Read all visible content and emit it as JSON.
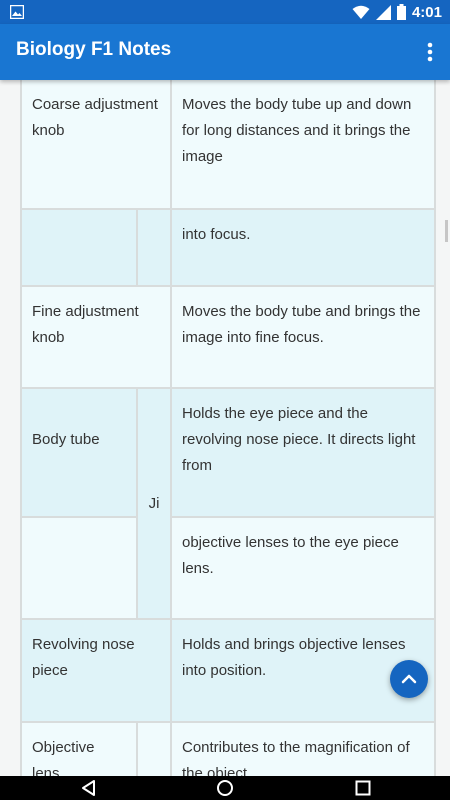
{
  "status_bar": {
    "time": "4:01",
    "icons": [
      "image-icon",
      "wifi-icon",
      "signal-icon",
      "battery-icon"
    ]
  },
  "app_bar": {
    "title": "Biology F1 Notes",
    "overflow_icon": "more-vert-icon"
  },
  "table": {
    "rows": [
      {
        "part": "Coarse adjustment knob",
        "function": "Moves the body tube up and down for long distances and it brings the image"
      },
      {
        "part": "",
        "function": "into focus."
      },
      {
        "part": "Fine adjustment knob",
        "function": "Moves the body tube and brings the image into fine focus."
      },
      {
        "part": "Body tube",
        "middle": "Ji",
        "function": "Holds the eye piece and the revolving nose piece. It directs light from"
      },
      {
        "part": "",
        "function": "objective lenses to the eye piece lens."
      },
      {
        "part": "Revolving nose piece",
        "function": "Holds and brings objective lenses into position."
      },
      {
        "part": "Objective lens",
        "function": "Contributes to the magnification of the object"
      }
    ]
  },
  "fab": {
    "icon": "chevron-up-icon"
  },
  "nav_bar": {
    "icons": [
      "back-icon",
      "home-icon",
      "recents-icon"
    ]
  },
  "colors": {
    "status_bar": "#1565c0",
    "app_bar": "#1976d2",
    "row_light": "#f0fbfd",
    "row_blue": "#dff3f8",
    "fab": "#1565c0"
  }
}
